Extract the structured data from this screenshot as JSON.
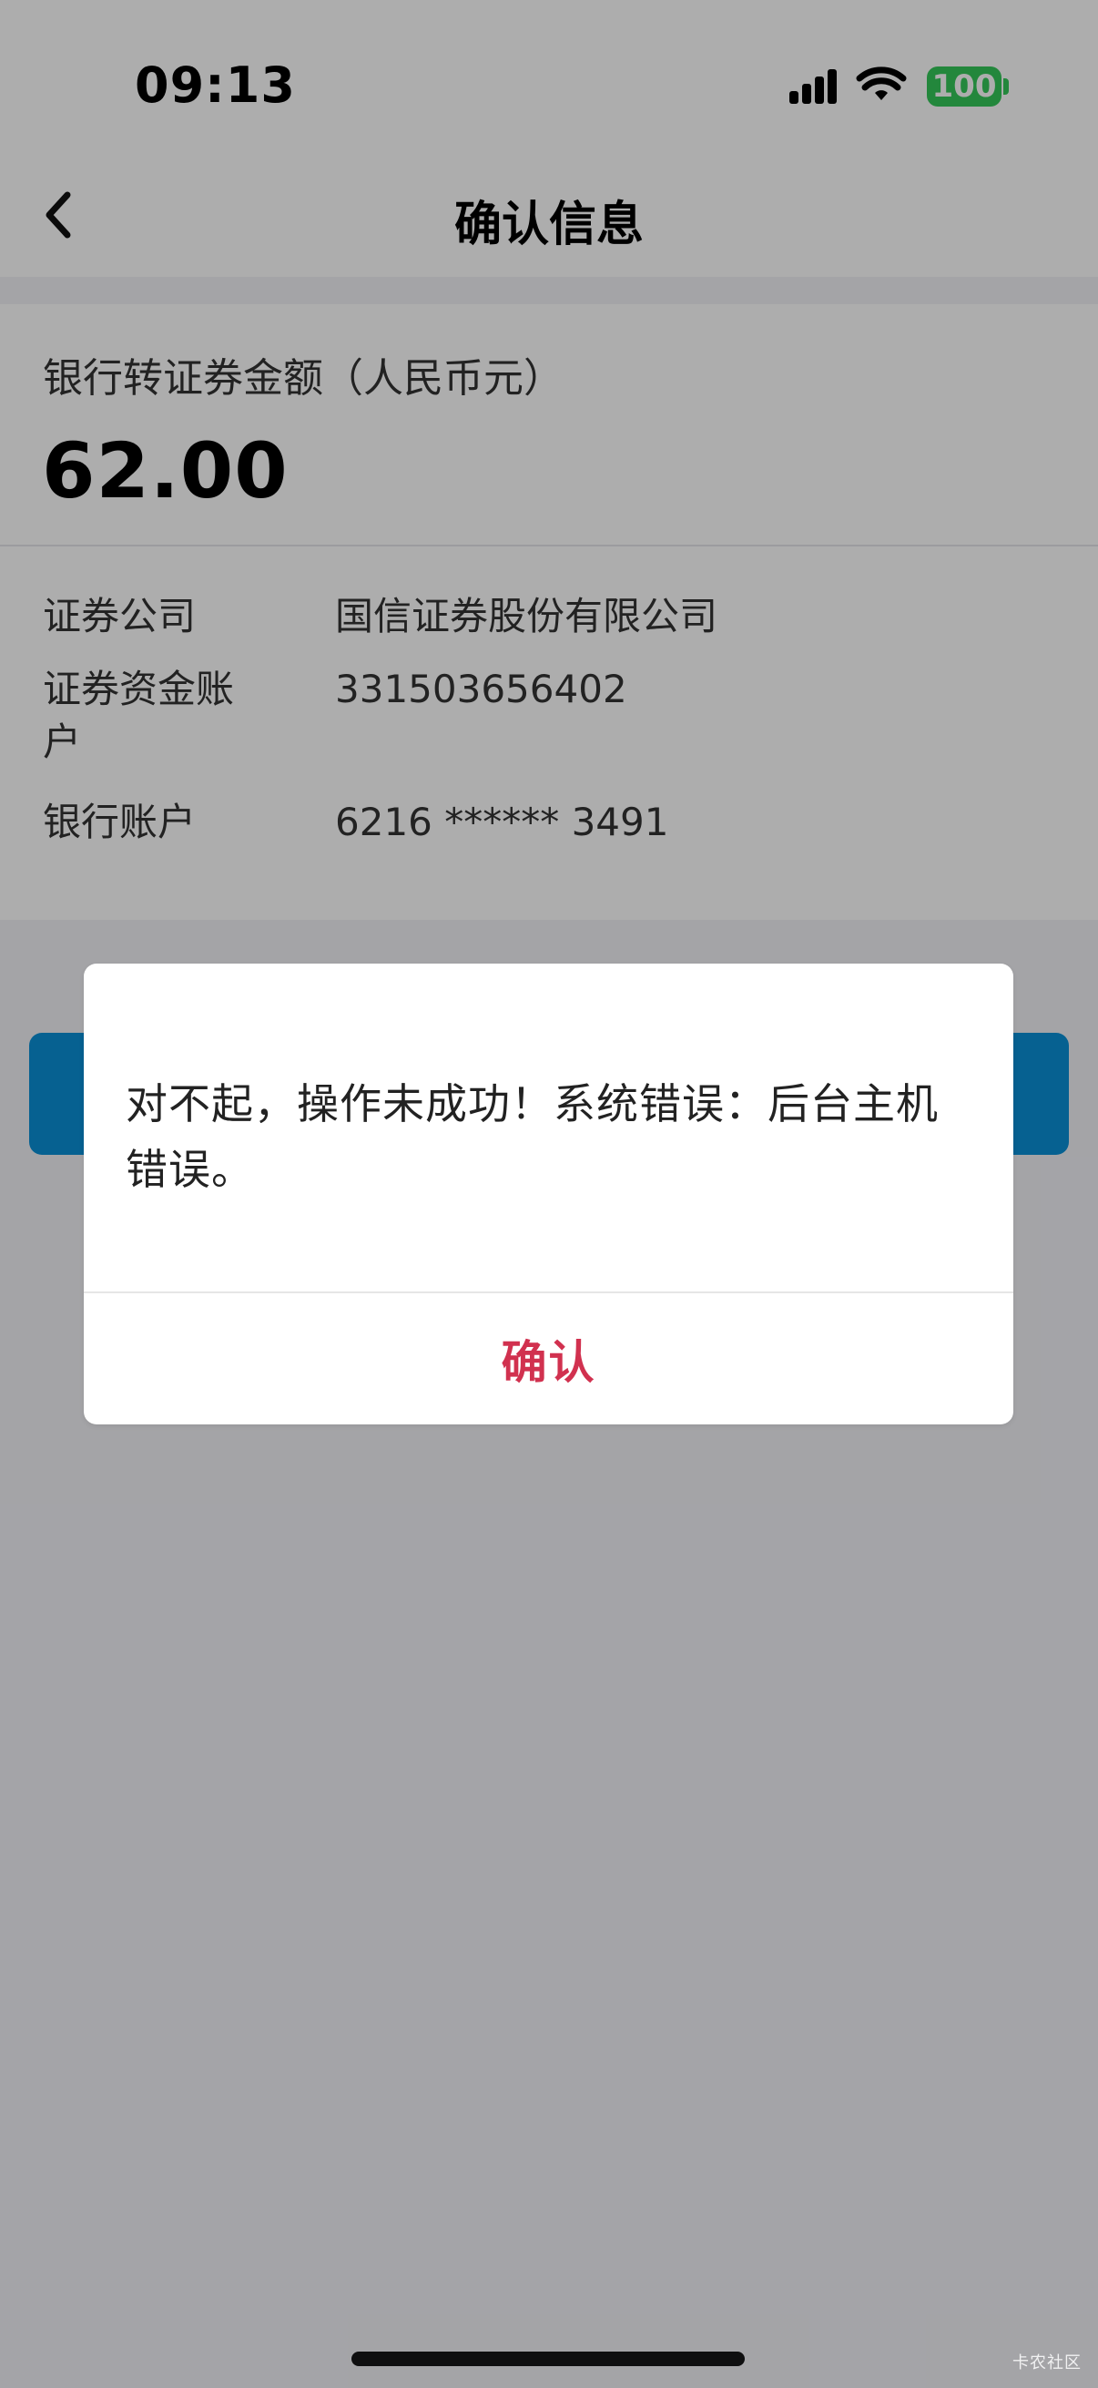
{
  "status_bar": {
    "time": "09:13",
    "battery": "100"
  },
  "nav": {
    "title": "确认信息"
  },
  "transfer": {
    "label": "银行转证券金额（人民币元）",
    "amount": "62.00"
  },
  "details": [
    {
      "key": "证券公司",
      "value": "国信证券股份有限公司"
    },
    {
      "key": "证券资金账户",
      "value": "331503656402"
    },
    {
      "key": "银行账户",
      "value": "6216 ****** 3491"
    }
  ],
  "dialog": {
    "message": "对不起，操作未成功！系统错误：后台主机错误。",
    "confirm_label": "确认"
  },
  "watermark": "卡农社区",
  "colors": {
    "primary_button": "#0A8FD6",
    "confirm_text": "#D1314F",
    "battery": "#34C759"
  }
}
